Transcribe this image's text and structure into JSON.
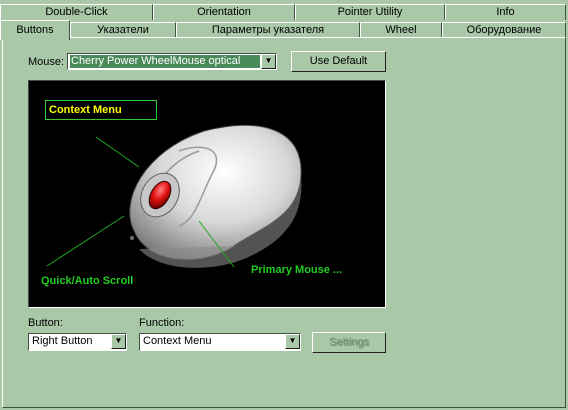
{
  "tabs_row1": [
    {
      "label": "Double-Click"
    },
    {
      "label": "Orientation"
    },
    {
      "label": "Pointer Utility"
    },
    {
      "label": "Info"
    }
  ],
  "tabs_row2": [
    {
      "label": "Buttons",
      "active": true
    },
    {
      "label": "Указатели"
    },
    {
      "label": "Параметры указателя"
    },
    {
      "label": "Wheel"
    },
    {
      "label": "Оборудование"
    }
  ],
  "mouse": {
    "label": "Mouse:",
    "value": "Cherry Power WheelMouse optical",
    "use_default_label": "Use Default"
  },
  "preview": {
    "callout_selected": "Context Menu",
    "callout_scroll": "Quick/Auto Scroll",
    "callout_primary": "Primary Mouse ..."
  },
  "button_field": {
    "label": "Button:",
    "value": "Right Button"
  },
  "function_field": {
    "label": "Function:",
    "value": "Context Menu"
  },
  "settings_label": "Settings",
  "colors": {
    "background": "#a8c8a8",
    "highlight": "#4a8a5a",
    "callout_green": "#22cc22",
    "callout_yellow": "#ffff00"
  }
}
